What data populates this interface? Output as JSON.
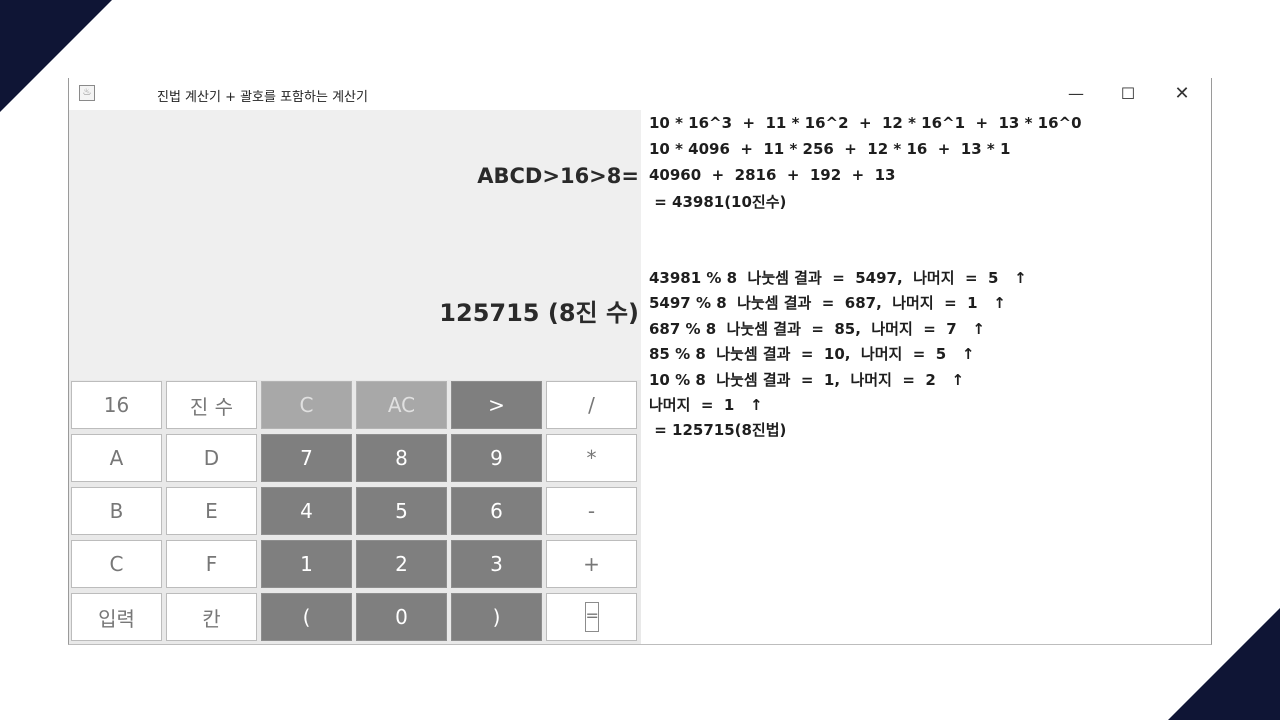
{
  "window": {
    "title": "진법 계산기 + 괄호를 포함하는 계산기",
    "icon": "java-cup-icon",
    "controls": {
      "minimize": "—",
      "maximize": "☐",
      "close": "✕"
    }
  },
  "display": {
    "expression": "ABCD>16>8=",
    "result": "125715 (8진 수)"
  },
  "keypad": {
    "rows": [
      [
        "16",
        "진 수",
        "C",
        "AC",
        ">",
        "/"
      ],
      [
        "A",
        "D",
        "7",
        "8",
        "9",
        "*"
      ],
      [
        "B",
        "E",
        "4",
        "5",
        "6",
        "-"
      ],
      [
        "C",
        "F",
        "1",
        "2",
        "3",
        "+"
      ],
      [
        "입력",
        "칸",
        "(",
        "0",
        ")",
        "="
      ]
    ]
  },
  "calculation_log": [
    "10 * 16^3  +  11 * 16^2  +  12 * 16^1  +  13 * 16^0",
    "10 * 4096  +  11 * 256  +  12 * 16  +  13 * 1",
    "40960  +  2816  +  192  +  13",
    " = 43981(10진수)",
    "43981 % 8  나눗셈 결과  =  5497,  나머지  =  5   ↑",
    "5497 % 8  나눗셈 결과  =  687,  나머지  =  1   ↑",
    "687 % 8  나눗셈 결과  =  85,  나머지  =  7   ↑",
    "85 % 8  나눗셈 결과  =  10,  나머지  =  5   ↑",
    "10 % 8  나눗셈 결과  =  1,  나머지  =  2   ↑",
    "나머지  =  1   ↑",
    " = 125715(8진법)"
  ],
  "colors": {
    "corner_accent": "#0f1535",
    "display_bg": "#efefef",
    "key_light": "#ffffff",
    "key_dark": "#7f7f7f",
    "key_mid": "#a8a8a8"
  }
}
